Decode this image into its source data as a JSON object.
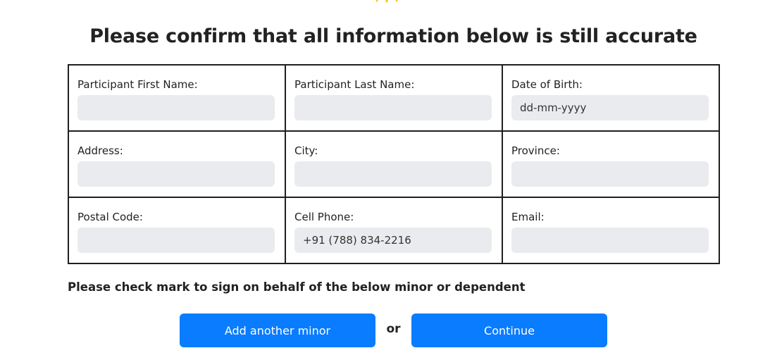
{
  "logo": {
    "icon": "logo-fragment-icon",
    "color": "#f5c518"
  },
  "heading": "Please confirm that all information below is still accurate",
  "fields": [
    {
      "label": "Participant First Name:",
      "value": "",
      "placeholder": ""
    },
    {
      "label": "Participant Last Name:",
      "value": "",
      "placeholder": ""
    },
    {
      "label": "Date of Birth:",
      "value": "",
      "placeholder": "dd-mm-yyyy"
    },
    {
      "label": "Address:",
      "value": "",
      "placeholder": ""
    },
    {
      "label": "City:",
      "value": "",
      "placeholder": ""
    },
    {
      "label": "Province:",
      "value": "",
      "placeholder": ""
    },
    {
      "label": "Postal Code:",
      "value": "",
      "placeholder": ""
    },
    {
      "label": "Cell Phone:",
      "value": "+91 (788) 834-2216",
      "placeholder": ""
    },
    {
      "label": "Email:",
      "value": "",
      "placeholder": ""
    }
  ],
  "sign_text": "Please check mark to sign on behalf of the below minor or dependent",
  "buttons": {
    "add_minor": "Add another minor",
    "or": "or",
    "continue": "Continue"
  },
  "colors": {
    "primary": "#0a7cff",
    "input_bg": "#e9ebee",
    "border": "#1f1f1f"
  }
}
